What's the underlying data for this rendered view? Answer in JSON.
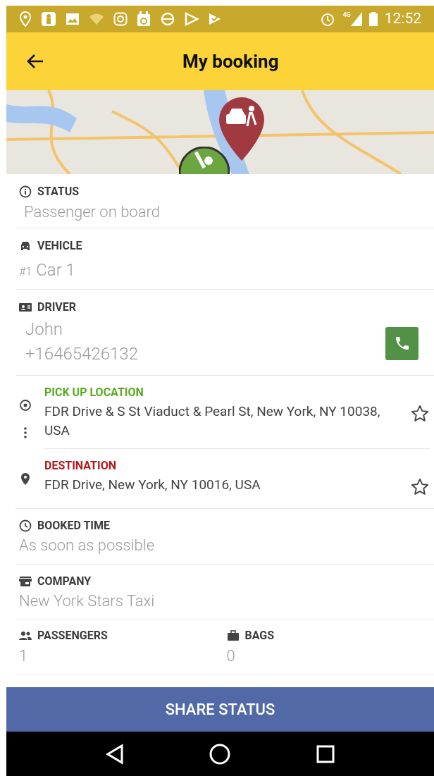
{
  "status_bar": {
    "network": "4G",
    "time": "12:52"
  },
  "app_bar": {
    "title": "My booking"
  },
  "sections": [
    {
      "kind": "status",
      "label": "STATUS",
      "value": "Passenger on board"
    },
    {
      "kind": "vehicle",
      "label": "VEHICLE",
      "number": "#1",
      "value": "Car 1"
    },
    {
      "kind": "driver",
      "label": "DRIVER",
      "name": "John",
      "phone": "+16465426132"
    }
  ],
  "route": [
    {
      "kind": "pickup",
      "label": "PICK UP LOCATION",
      "color": "#5aab1e",
      "address": "FDR Drive & S St Viaduct & Pearl St, New York, NY 10038, USA"
    },
    {
      "kind": "destination",
      "label": "DESTINATION",
      "color": "#b3171c",
      "address": "FDR Drive, New York, NY 10016, USA"
    }
  ],
  "details": [
    {
      "kind": "time",
      "label": "BOOKED TIME",
      "value": "As soon as possible"
    },
    {
      "kind": "company",
      "label": "COMPANY",
      "value": "New York Stars Taxi"
    }
  ],
  "counts": [
    {
      "kind": "passengers",
      "label": "PASSENGERS",
      "value": "1"
    },
    {
      "kind": "bags",
      "label": "BAGS",
      "value": "0"
    }
  ],
  "share_button": "SHARE STATUS"
}
